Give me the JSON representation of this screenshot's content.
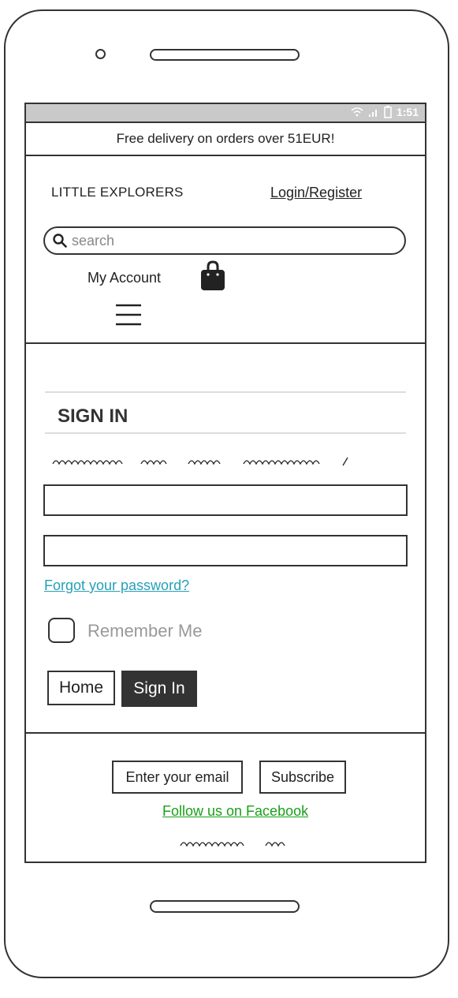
{
  "status_bar": {
    "time": "1:51"
  },
  "promo_banner": {
    "text": "Free delivery on orders over 51EUR!"
  },
  "header": {
    "brand": "LITTLE EXPLORERS",
    "login_link": "Login/Register",
    "search": {
      "placeholder": "search",
      "value": ""
    },
    "my_account": "My Account"
  },
  "signin": {
    "title": "SIGN IN",
    "forgot_password": "Forgot your password?",
    "remember_me": "Remember Me",
    "remember_checked": false,
    "home_button": "Home",
    "signin_button": "Sign In"
  },
  "footer": {
    "email_placeholder": "Enter your email",
    "subscribe_button": "Subscribe",
    "facebook_link": "Follow us on Facebook"
  },
  "colors": {
    "link_teal": "#26a0b8",
    "link_green": "#19a019",
    "primary_button": "#333333",
    "status_bar": "#c9c9c9"
  },
  "icons": [
    "wifi-icon",
    "signal-icon",
    "battery-icon",
    "search-icon",
    "shopping-bag-icon",
    "hamburger-menu-icon"
  ]
}
